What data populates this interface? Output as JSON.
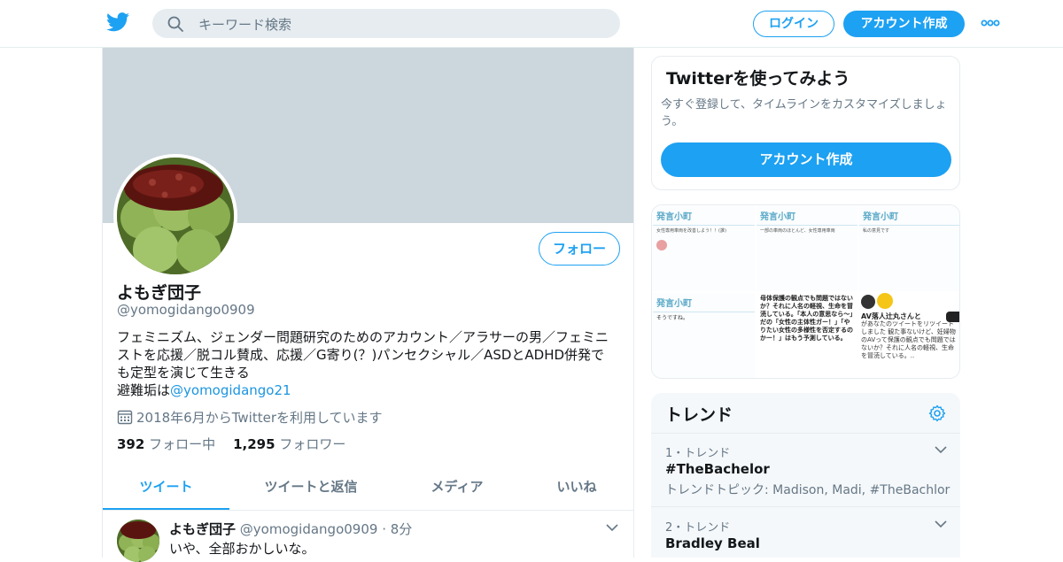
{
  "header": {
    "search_placeholder": "キーワード検索",
    "login_label": "ログイン",
    "signup_label": "アカウント作成",
    "brand_color": "#1da1f2"
  },
  "profile": {
    "display_name": "よもぎ団子",
    "screen_name": "@yomogidango0909",
    "follow_label": "フォロー",
    "bio_text": "フェミニズム、ジェンダー問題研究のためのアカウント／アラサーの男／フェミニストを応援／脱コル賛成、応援／G寄り(？)パンセクシャル／ASDとADHD併発でも定型を演じて生きる\n避難垢は",
    "bio_link": "@yomogidango21",
    "joined": "2018年6月からTwitterを利用しています",
    "following_count": "392",
    "following_label": "フォロー中",
    "followers_count": "1,295",
    "followers_label": "フォロワー"
  },
  "tabs": [
    {
      "label": "ツイート"
    },
    {
      "label": "ツイートと返信"
    },
    {
      "label": "メディア"
    },
    {
      "label": "いいね"
    }
  ],
  "tweet": {
    "author": "よもぎ団子",
    "handle": "@yomogidango0909",
    "sep": "·",
    "time": "8分",
    "text": "いや、全部おかしいな。"
  },
  "signup_card": {
    "title": "Twitterを使ってみよう",
    "text": "今すぐ登録して、タイムラインをカスタマイズしましょう。",
    "button": "アカウント作成"
  },
  "media": {
    "cells": [
      {
        "heading": "発言小町",
        "caption": "女性専用車両を改善しよう！！(誰)"
      },
      {
        "heading": "発言小町",
        "caption": "一部の車両のほとんど、女性専用車両"
      },
      {
        "heading": "発言小町",
        "caption": "私の意見です"
      },
      {
        "heading": "発言小町",
        "caption": "そうですね。"
      },
      {
        "heading": "",
        "caption": "母体保護の観点でも問題ではないか？それに人名の軽視、生命を冒涜している。「本人の意思なら〜」だの「女性の主体性ガー！」「やりたい女性の多様性を否定するのかー！」はもう予測している。"
      },
      {
        "heading": "AV落人辻丸さんと",
        "caption": "があなたのツイートをリツイートしました 観た事ないけど、妊婦物のAVって保護の観点でも問題ではないか？それに人名の軽視、生命を冒涜している。.."
      }
    ]
  },
  "trends": {
    "title": "トレンド",
    "items": [
      {
        "meta": "1・トレンド",
        "name": "#TheBachelor",
        "desc": "トレンドトピック: Madison, Madi, #TheBachlor"
      },
      {
        "meta": "2・トレンド",
        "name": "Bradley Beal",
        "desc": ""
      }
    ]
  }
}
